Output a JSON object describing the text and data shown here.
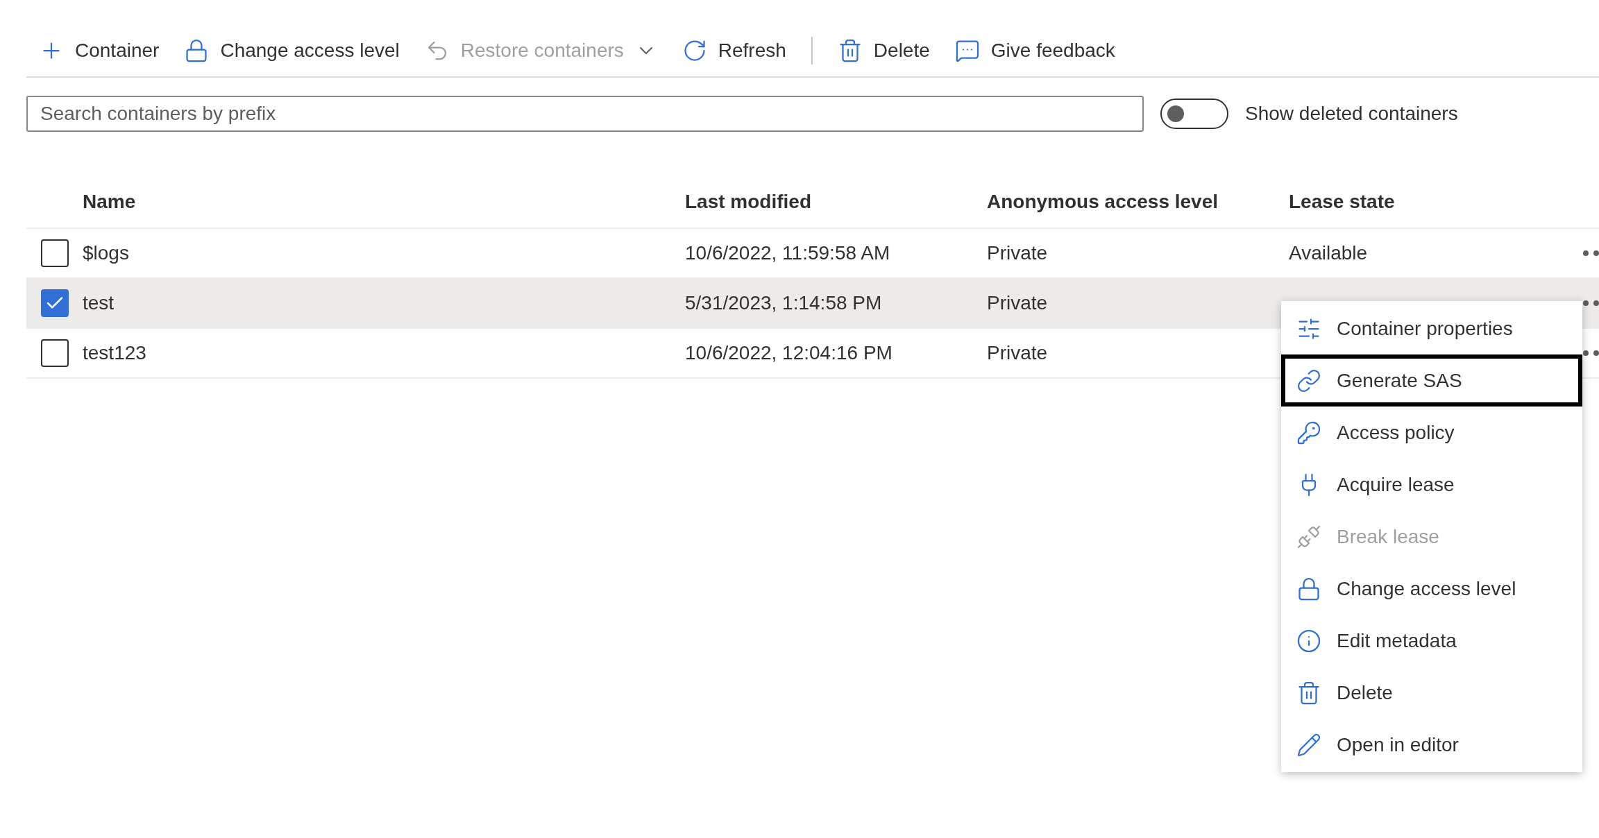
{
  "toolbar": [
    {
      "kind": "button",
      "label": "Container",
      "disabled": false,
      "dropdown": false
    },
    {
      "kind": "button",
      "label": "Change access level",
      "disabled": false,
      "dropdown": false
    },
    {
      "kind": "button",
      "label": "Restore containers",
      "disabled": true,
      "dropdown": true
    },
    {
      "kind": "button",
      "label": "Refresh",
      "disabled": false,
      "dropdown": false
    },
    {
      "kind": "separator"
    },
    {
      "kind": "button",
      "label": "Delete",
      "disabled": false,
      "dropdown": false
    },
    {
      "kind": "button",
      "label": "Give feedback",
      "disabled": false,
      "dropdown": false
    }
  ],
  "search": {
    "placeholder": "Search containers by prefix"
  },
  "show_deleted": {
    "label": "Show deleted containers",
    "on": false
  },
  "table": {
    "columns": [
      "Name",
      "Last modified",
      "Anonymous access level",
      "Lease state"
    ],
    "rows": [
      {
        "selected": false,
        "cells": [
          "$logs",
          "10/6/2022, 11:59:58 AM",
          "Private",
          "Available"
        ]
      },
      {
        "selected": true,
        "cells": [
          "test",
          "5/31/2023, 1:14:58 PM",
          "Private"
        ]
      },
      {
        "selected": false,
        "cells": [
          "test123",
          "10/6/2022, 12:04:16 PM",
          "Private"
        ]
      }
    ]
  },
  "context_menu": {
    "items": [
      {
        "label": "Container properties",
        "disabled": false,
        "focused": false
      },
      {
        "label": "Generate SAS",
        "disabled": false,
        "focused": true
      },
      {
        "label": "Access policy",
        "disabled": false,
        "focused": false
      },
      {
        "label": "Acquire lease",
        "disabled": false,
        "focused": false
      },
      {
        "label": "Break lease",
        "disabled": true,
        "focused": false
      },
      {
        "label": "Change access level",
        "disabled": false,
        "focused": false
      },
      {
        "label": "Edit metadata",
        "disabled": false,
        "focused": false
      },
      {
        "label": "Delete",
        "disabled": false,
        "focused": false
      },
      {
        "label": "Open in editor",
        "disabled": false,
        "focused": false
      }
    ]
  }
}
